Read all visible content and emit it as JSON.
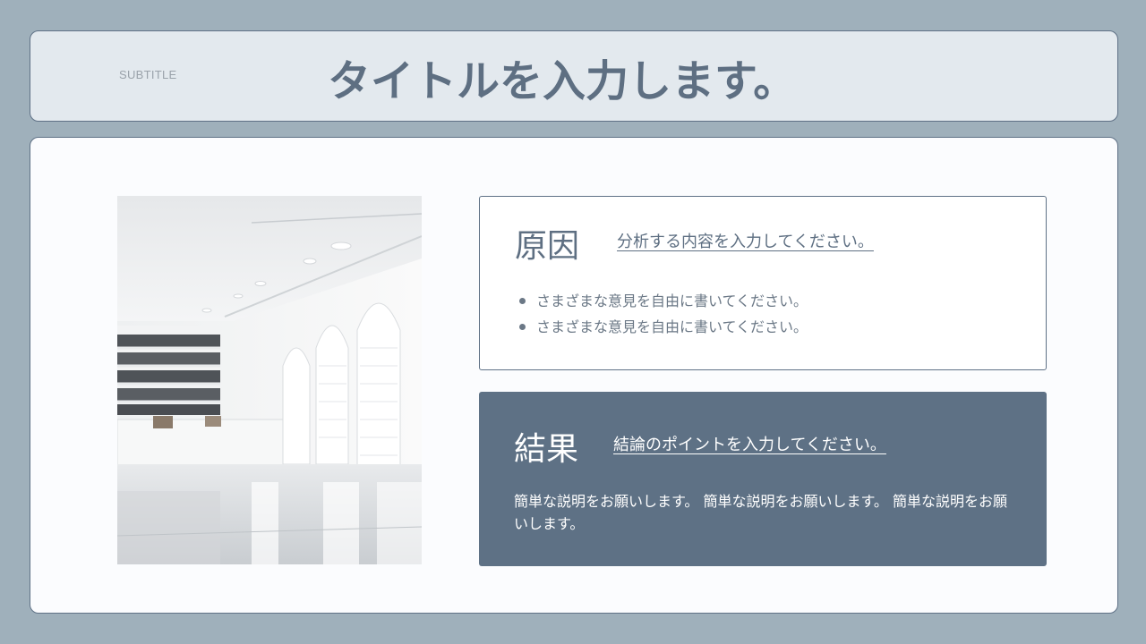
{
  "header": {
    "subtitle": "SUBTITLE",
    "title": "タイトルを入力します。"
  },
  "image": {
    "icon": "interior-photo",
    "description_colors": [
      "#ffffff",
      "#d9dcde",
      "#4a4d52"
    ]
  },
  "cause": {
    "heading": "原因",
    "lead": "分析する内容を入力してください。",
    "bullets": [
      "さまざまな意見を自由に書いてください。",
      "さまざまな意見を自由に書いてください。"
    ]
  },
  "result": {
    "heading": "結果",
    "lead": "結論のポイントを入力してください。",
    "text": "簡単な説明をお願いします。 簡単な説明をお願いします。 簡単な説明をお願いします。"
  },
  "colors": {
    "background": "#9fb0bb",
    "accent": "#5e7185",
    "panel": "#e3e9ee",
    "card": "#fbfcfe"
  }
}
